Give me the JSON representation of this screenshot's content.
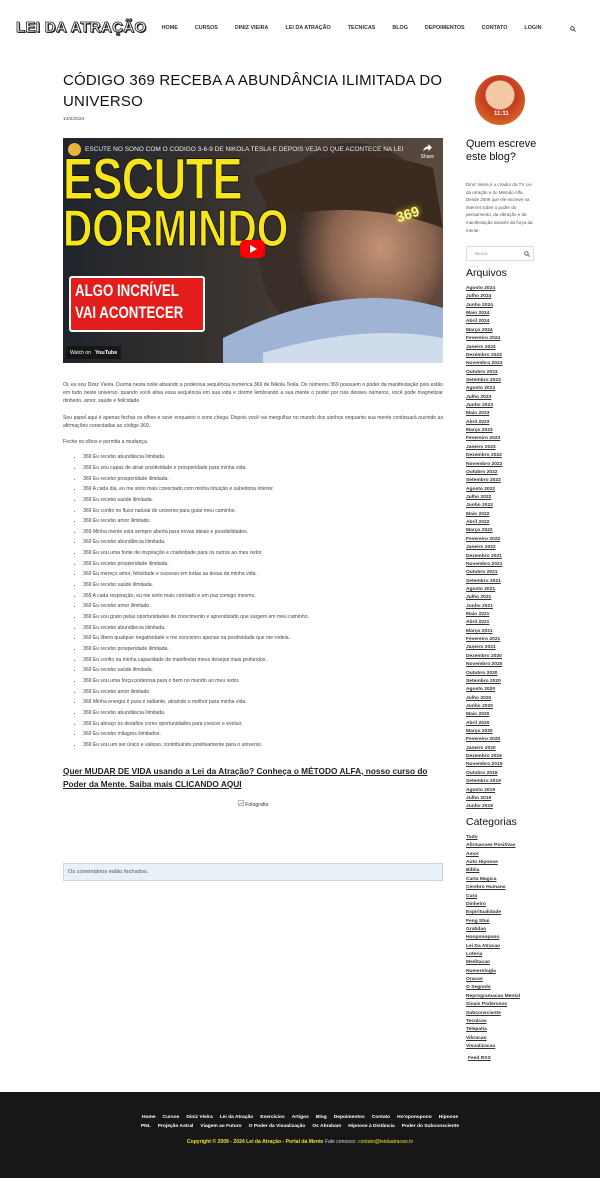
{
  "site": {
    "logo": "LEI DA ATRAÇÃO"
  },
  "nav": {
    "items": [
      "Home",
      "CURSOS",
      "DINIZ VIEIRA",
      "LEI DA ATRAÇÃO",
      "TECNICAS",
      "BLOG",
      "DEPOIMENTOS",
      "CONTATO",
      "LOGIN"
    ],
    "search_icon": "search-icon"
  },
  "post": {
    "title": "CÓDIGO 369 RECEBA A ABUNDÂNCIA ILIMITADA DO UNIVERSO",
    "date": "14/2/2024",
    "video": {
      "title": "ESCUTE NO SONO COM O CÓDIGO 3-6-9 DE NIKOLA TESLA E DEPOIS VEJA O QUE ACONTECE NA LEI DA ATR...",
      "share": "Share",
      "big1": "ESCUTE",
      "big2": "DORMINDO",
      "sub1": "ALGO INCRÍVEL",
      "sub2": "VAI ACONTECER",
      "overlay": "369",
      "watch_on": "Watch on",
      "youtube": "YouTube"
    },
    "paragraphs": [
      "Oi, eu sou Diniz Vieira. Durma nesta noite ativando a poderosa sequência numérica 369 de Nikola Tesla. Os números 369 possuem o poder da manifestação pois estão em tudo neste universo, quando você ativa essa sequência em sua vida e dormir lembrando a sua mente o poder por trás desses números, você pode magnetizar dinheiro, amor, saúde e felicidade.",
      "Seu papel aqui é apenas fechar os olhos e ouvir enquanto o sono chega. Depois você vai mergulhar no mundo dos sonhos enquanto sua mente continuará ouvindo as afirmações conectadas ao código 369."
    ],
    "lead": "Feche os olhos e permita a mudança.",
    "affirmations": [
      "369 Eu recebo abundância ilimitada.",
      "369 Eu sou capaz de atrair positividade e prosperidade para minha vida.",
      "369 Eu recebo prosperidade ilimitada.",
      "369 A cada dia, eu me sinto mais conectado com minha intuição e sabedoria interior.",
      "369 Eu recebo saúde ilimitada.",
      "369 Eu confio no fluxo natural do universo para guiar meu caminho.",
      "369 Eu recebo amor ilimitado.",
      "369 Minha mente está sempre aberta para novas ideias e possibilidades.",
      "369 Eu recebo abundância ilimitada.",
      "369 Eu sou uma fonte de inspiração e criatividade para os outros ao meu redor.",
      "369 Eu recebo prosperidade ilimitada.",
      "369 Eu mereço amor, felicidade e sucesso em todas as áreas da minha vida.",
      "369 Eu recebo saúde ilimitada.",
      "369 A cada respiração, eu me sinto mais centrado e em paz comigo mesmo.",
      "369 Eu recebo amor ilimitado.",
      "369 Eu sou grato pelas oportunidades de crescimento e aprendizado que surgem em meu caminho.",
      "369 Eu recebo abundância ilimitada.",
      "369 Eu libero qualquer negatividade e me concentro apenas na positividade que me rodeia.",
      "369 Eu recebo prosperidade ilimitada.",
      "369 Eu confio na minha capacidade de manifestar meus desejos mais profundos.",
      "369 Eu recebo saúde ilimitada.",
      "369 Eu sou uma força poderosa para o bem no mundo ao meu redor.",
      "369 Eu recebo amor ilimitado.",
      "369 Minha energia é pura e radiante, atraindo o melhor para minha vida.",
      "369 Eu recebo abundância ilimitada.",
      "369 Eu abraço os desafios como oportunidades para crescer e evoluir.",
      "369 Eu recebo milagres ilimitados.",
      "369 Eu sou um ser único e valioso, contribuindo positivamente para o universo."
    ],
    "cta": "Quer MUDAR DE VIDA usando a Lei da Atração? Conheça o MÉTODO ALFA, nosso curso do Poder da Mente. Saiba mais CLICANDO AQUI",
    "photo_alt": "Fotografia",
    "comments_closed": "Os comentários estão fechados."
  },
  "sidebar": {
    "author_badge": "11:11",
    "who_title": "Quem escreve este blog?",
    "who_text": "Diniz Vieira é o criador da TV Lei da Atração e do Método Alfa. Desde 2009 que ele escreve na internet sobre o poder do pensamento, da vibração e da manifestação através da força da mente.",
    "search_placeholder": "Busca",
    "archives_title": "Arquivos",
    "archives": [
      "Agosto 2024",
      "Julho 2024",
      "Junho 2024",
      "Maio 2024",
      "Abril 2024",
      "Março 2024",
      "Fevereiro 2024",
      "Janeiro 2024",
      "Dezembro 2023",
      "Novembro 2023",
      "Outubro 2023",
      "Setembro 2023",
      "Agosto 2023",
      "Julho 2023",
      "Junho 2023",
      "Maio 2023",
      "Abril 2023",
      "Março 2023",
      "Fevereiro 2023",
      "Janeiro 2023",
      "Dezembro 2022",
      "Novembro 2022",
      "Outubro 2022",
      "Setembro 2022",
      "Agosto 2022",
      "Julho 2022",
      "Junho 2022",
      "Maio 2022",
      "Abril 2022",
      "Março 2022",
      "Fevereiro 2022",
      "Janeiro 2022",
      "Dezembro 2021",
      "Novembro 2021",
      "Outubro 2021",
      "Setembro 2021",
      "Agosto 2021",
      "Julho 2021",
      "Junho 2021",
      "Maio 2021",
      "Abril 2021",
      "Março 2021",
      "Fevereiro 2021",
      "Janeiro 2021",
      "Dezembro 2020",
      "Novembro 2020",
      "Outubro 2020",
      "Setembro 2020",
      "Agosto 2020",
      "Julho 2020",
      "Junho 2020",
      "Maio 2020",
      "Abril 2020",
      "Março 2020",
      "Fevereiro 2020",
      "Janeiro 2020",
      "Dezembro 2019",
      "Novembro 2019",
      "Outubro 2019",
      "Setembro 2019",
      "Agosto 2019",
      "Julho 2019",
      "Junho 2019"
    ],
    "categories_title": "Categorias",
    "categories": [
      "Tudo",
      "Afirmacoes Positivas",
      "Amor",
      "Auto Hipnose",
      "Biblia",
      "Carta Magica",
      "Cerebro Humano",
      "Cura",
      "Dinheiro",
      "Espiritualidade",
      "Feng Shui",
      "Gratidao",
      "Hooponopono",
      "Lei Da Atracao",
      "Loteria",
      "Meditacao",
      "Numerologia",
      "Oracao",
      "O Segredo",
      "Reprogramacao Mental",
      "Sinais Poderosos",
      "Subconsciente",
      "Tecnicas",
      "Telepatia",
      "Vibracao",
      "Visualizacao"
    ],
    "feed": "Feed RSS"
  },
  "footer": {
    "links1": [
      "Home",
      "Cursos",
      "Diniz Vieira",
      "Lei da Atração",
      "Exercícios",
      "Artigos",
      "Blog",
      "Depoimentos",
      "Contato",
      "Ho'oponopono",
      "Hipnose"
    ],
    "links2": [
      "PNL",
      "Projeção Astral",
      "Viagem ao Futuro",
      "O Poder da Visualização",
      "Os Abraham",
      "Hipnose à Distância",
      "Poder do Subconsciente"
    ],
    "copyright": "Copyright © 2009 - 2024 Lei da Atração - Portal da Mente",
    "contact_label": "Fale conosco:",
    "contact_email": "contato@leidaatracao.tv"
  },
  "colors": {
    "accent_yellow": "#f2e01a",
    "footer_bg": "#17171a",
    "youtube_red": "#ff0000"
  }
}
